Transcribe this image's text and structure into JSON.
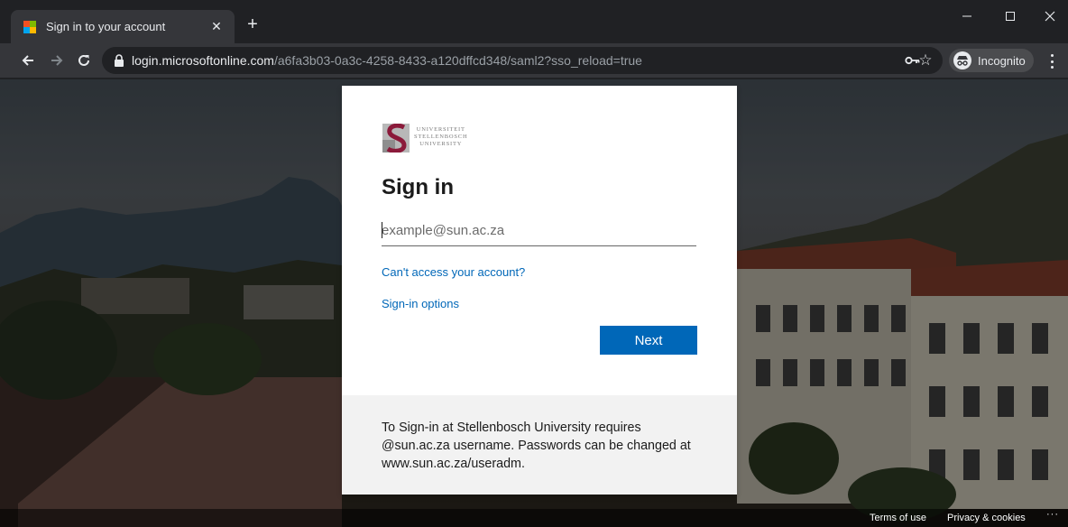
{
  "browser": {
    "tab_title": "Sign in to your account",
    "tab_close_glyph": "✕",
    "new_tab_glyph": "+",
    "url_host": "login.microsoftonline.com",
    "url_path": "/a6fa3b03-0a3c-4258-8433-a120dffcd348/saml2?sso_reload=true",
    "incognito_label": "Incognito",
    "star_glyph": "☆",
    "favicon_colors": [
      "#f25022",
      "#7fba00",
      "#00a4ef",
      "#ffb900"
    ]
  },
  "card": {
    "org_wordmark": [
      "UNIVERSITEIT",
      "STELLENBOSCH",
      "UNIVERSITY"
    ],
    "heading": "Sign in",
    "email_placeholder": "example@sun.ac.za",
    "cant_access_link": "Can't access your account?",
    "signin_options_link": "Sign-in options",
    "next_button": "Next",
    "footer_text": "To Sign-in at Stellenbosch University requires @sun.ac.za username. Passwords can be changed at www.sun.ac.za/useradm."
  },
  "footer": {
    "terms": "Terms of use",
    "privacy": "Privacy & cookies",
    "more": "···"
  },
  "colors": {
    "accent": "#0067b8",
    "brand_maroon": "#8b1a3a"
  }
}
